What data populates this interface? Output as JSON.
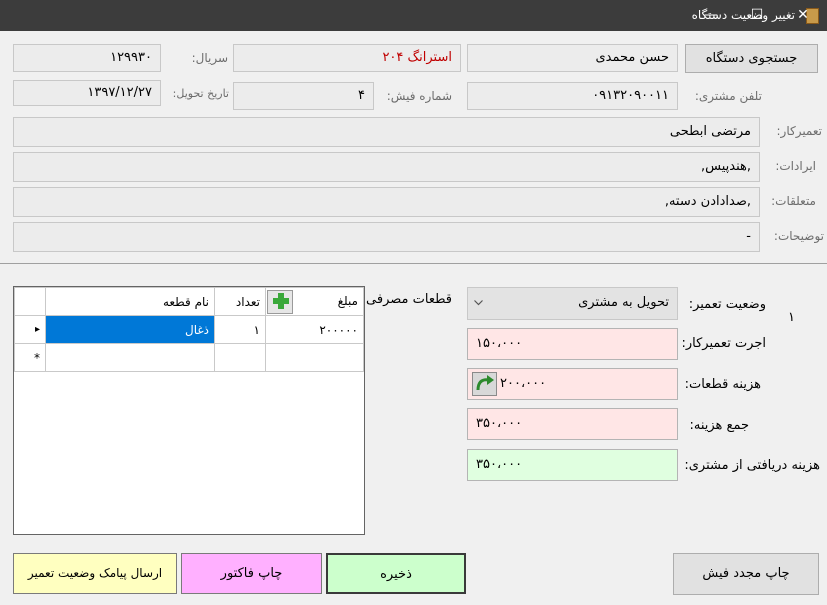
{
  "window": {
    "title": "تغییر وضعیت دستگاه",
    "controls": [
      "—",
      "☐",
      "✕"
    ]
  },
  "top": {
    "search_button": "جستجوی دستگاه",
    "customer_name": "حسن محمدی",
    "device": "استرانگ ۲۰۴",
    "serial_label": "سریال:",
    "serial_value": "۱۲۹۹۳۰",
    "phone_label": "تلفن مشتری:",
    "phone_value": "۰۹۱۳۲۰۹۰۰۱۱",
    "receipt_label": "شماره فیش:",
    "receipt_value": "۴",
    "delivery_date_label": "تاریخ تحویل:",
    "delivery_date_value": "۱۳۹۷/۱۲/۲۷",
    "repairman_label": "تعمیرکار:",
    "repairman_value": "مرتضی ابطحی",
    "issues_label": "ایرادات:",
    "issues_value": ",هندپیس,",
    "accessories_label": "متعلقات:",
    "accessories_value": ",صدادادن دسته,",
    "notes_label": "توضیحات:",
    "notes_value": "-"
  },
  "bottom": {
    "status_label": "وضعیت تعمیر:",
    "status_value": "تحویل به مشتری",
    "side_number": "۱",
    "labor_label": "اجرت تعمیرکار:",
    "labor_value": "۱۵۰،۰۰۰",
    "parts_cost_label": "هزینه قطعات:",
    "parts_cost_value": "۲۰۰،۰۰۰",
    "total_label": "جمع هزینه:",
    "total_value": "۳۵۰،۰۰۰",
    "received_label": "هزینه دریافتی از مشتری:",
    "received_value": "۳۵۰،۰۰۰",
    "parts_label": "قطعات مصرفی:",
    "grid": {
      "headers": {
        "name": "نام قطعه",
        "qty": "تعداد",
        "amount": "مبلغ"
      },
      "rows": [
        {
          "name": "ذغال",
          "qty": "۱",
          "amount": "۲۰۰۰۰۰"
        }
      ],
      "new_row_marker": "*",
      "current_row_marker": "▸",
      "add_icon": "+"
    },
    "buttons": {
      "sms": "ارسال پیامک وضعیت تعمیر",
      "invoice": "چاپ فاکتور",
      "save": "ذخیره",
      "reprint": "چاپ مجدد فیش"
    }
  },
  "colors": {
    "pink": "#ffe6e6",
    "green": "#ccffcc",
    "invoice_pink": "#ffb0ff",
    "sms_yellow": "#ffffc0",
    "selected_cell": "#0078d7"
  }
}
